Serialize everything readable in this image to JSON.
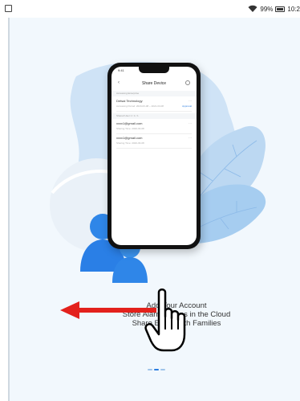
{
  "status_bar": {
    "battery_text": "99%",
    "time_text": "10:2"
  },
  "phone": {
    "header_title": "Share Device",
    "section_1_label": "Accessing Enterprise",
    "item_1_title": "Detsai Technology",
    "item_1_sub": "Accessing Period: 2020-03-08 ~ 2021-03-08",
    "item_1_action": "Approval",
    "section_2_label": "Shared User 1 / 1 / 1",
    "item_2_title": "xxxx1@gmail.com",
    "item_2_sub": "Sharing Time: 2020-03-08",
    "item_3_title": "xxxx1@gmail.com",
    "item_3_sub": "Sharing Time: 2020-03-08"
  },
  "onboarding": {
    "line_1": "Add Your Account",
    "line_2": "Store Alarm Videos in the Cloud",
    "line_3": "Share Easily with Families"
  },
  "colors": {
    "accent": "#2b7de0",
    "swipe_arrow": "#e3211c",
    "background": "#f2f8fd"
  }
}
